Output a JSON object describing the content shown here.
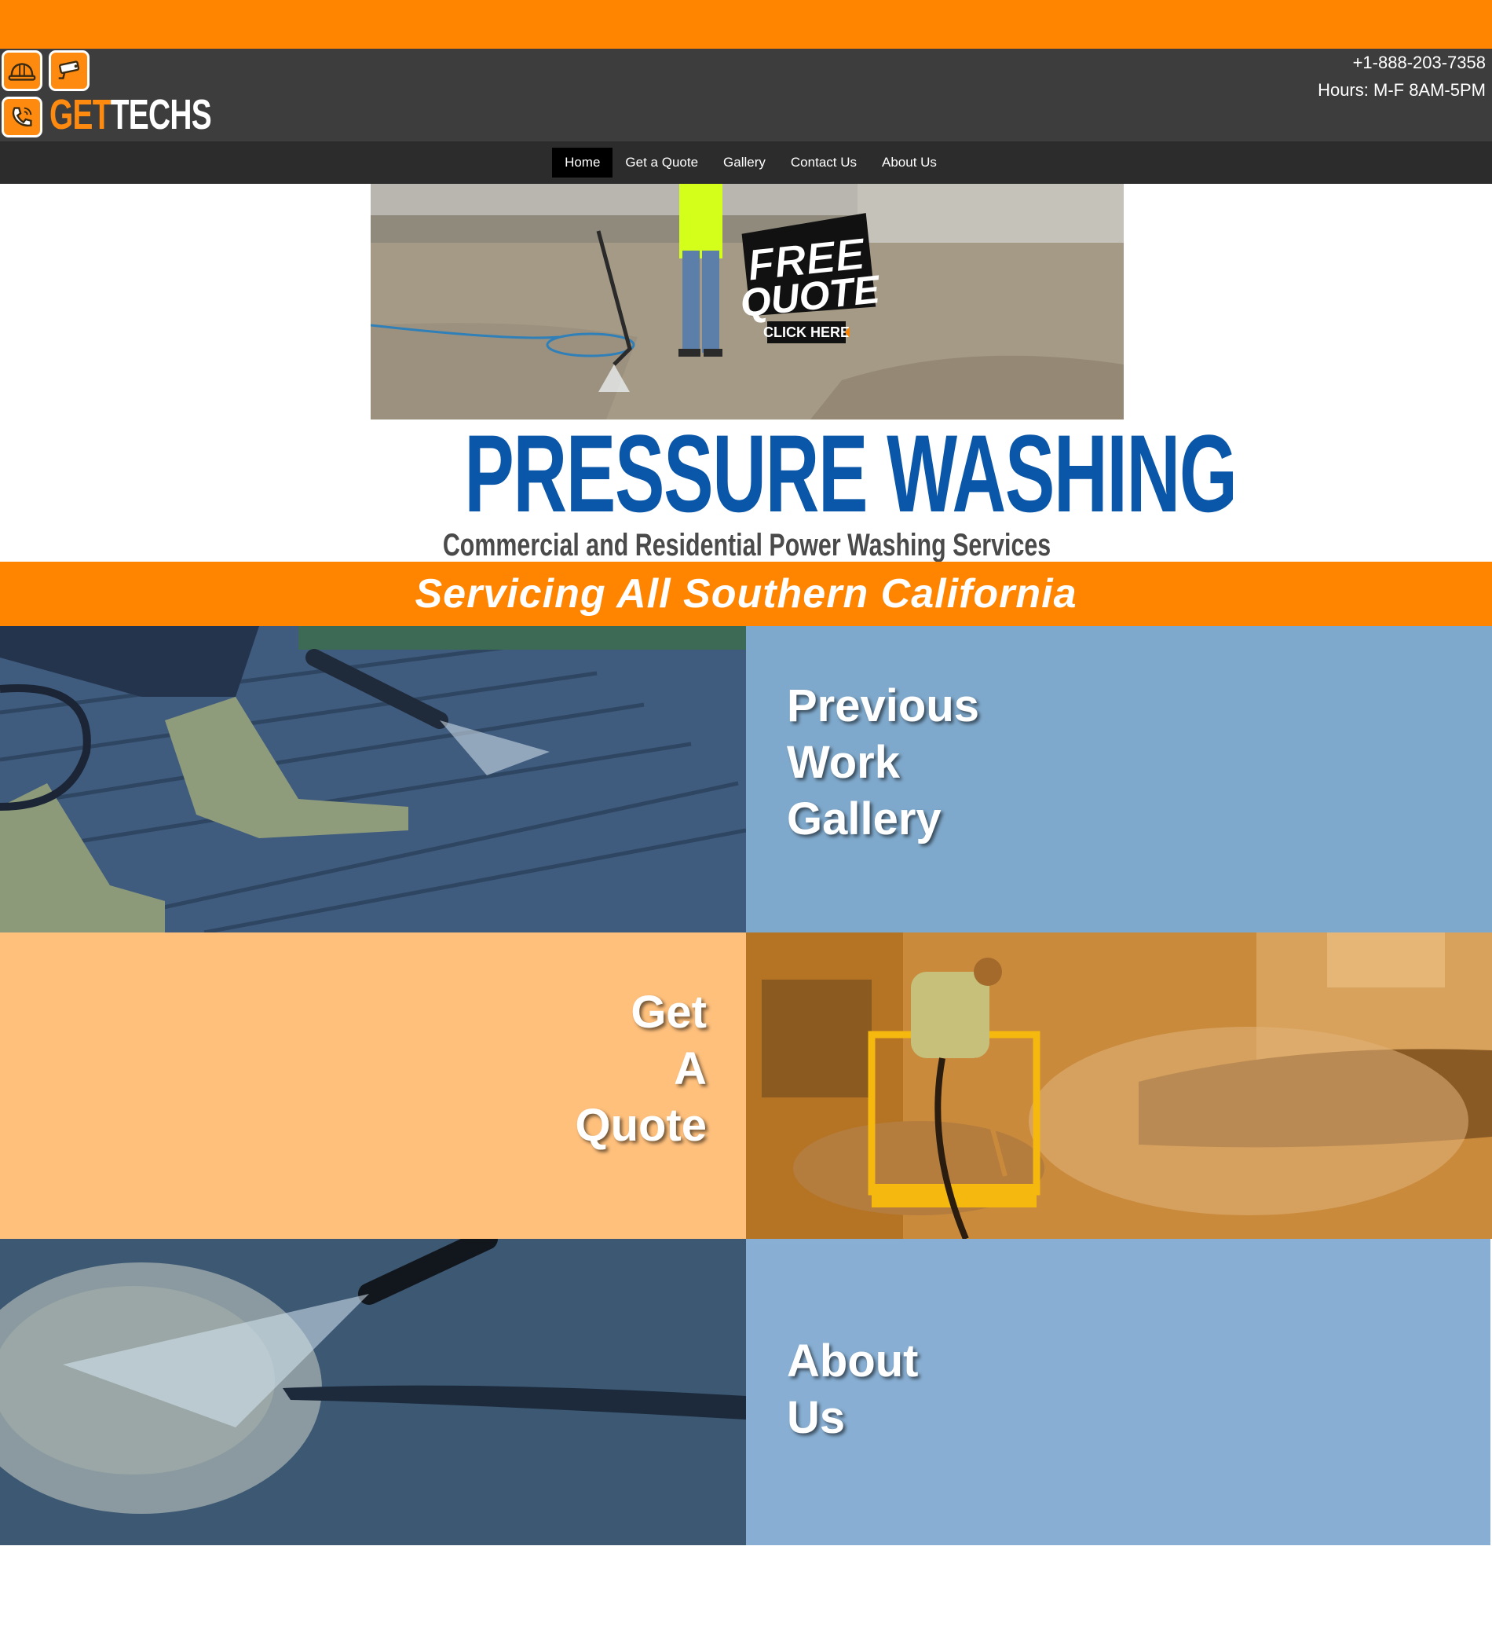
{
  "header": {
    "logo": {
      "get": "GET",
      "techs": "TECHS"
    },
    "icons": [
      "hardhat-icon",
      "security-camera-icon",
      "phone-icon"
    ],
    "phone": "+1-888-203-7358",
    "hours": "Hours: M-F 8AM-5PM"
  },
  "nav": {
    "items": [
      {
        "label": "Home",
        "active": true
      },
      {
        "label": "Get a Quote",
        "active": false
      },
      {
        "label": "Gallery",
        "active": false
      },
      {
        "label": "Contact Us",
        "active": false
      },
      {
        "label": "About Us",
        "active": false
      }
    ]
  },
  "hero": {
    "badge_line1": "FREE",
    "badge_line2": "QUOTE",
    "badge_cta": "CLICK HERE"
  },
  "banner": {
    "title": "PRESSURE WASHING",
    "subtitle": "Commercial and Residential Power Washing Services"
  },
  "service_area": "Servicing All Southern California",
  "tiles": {
    "gallery": "Previous\nWork\nGallery",
    "quote": "Get\nA\nQuote",
    "about": "About\nUs"
  },
  "colors": {
    "orange": "#ff8400",
    "header_gray": "#3d3d3d",
    "nav_dark": "#2c2c2c",
    "brand_blue": "#0a56a8",
    "tile_blue": "#7fa9cc",
    "tile_orange": "#ffc07c"
  }
}
